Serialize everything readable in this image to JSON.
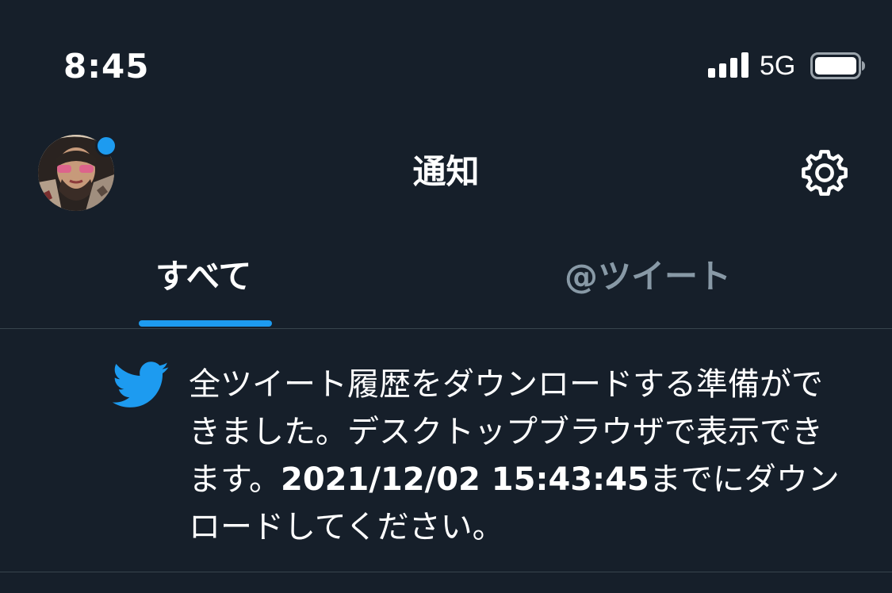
{
  "status_bar": {
    "time": "8:45",
    "network": "5G",
    "signal_icon": "cellular-signal-icon",
    "battery_icon": "battery-icon"
  },
  "header": {
    "title": "通知",
    "avatar": "profile-avatar",
    "settings_icon": "gear-icon"
  },
  "tabs": [
    {
      "label": "すべて",
      "selected": true
    },
    {
      "label": "@ツイート",
      "selected": false
    }
  ],
  "notification": {
    "icon": "twitter-bird-icon",
    "text_before": "全ツイート履歴をダウンロードする準備ができました。デスクトップブラウザで表示できます。",
    "deadline": "2021/12/02 15:43:45",
    "text_after": "までにダウンロードしてください。"
  },
  "colors": {
    "background": "#161f2a",
    "accent": "#1d9bf0",
    "muted": "#8899a6",
    "divider": "#38444d"
  }
}
